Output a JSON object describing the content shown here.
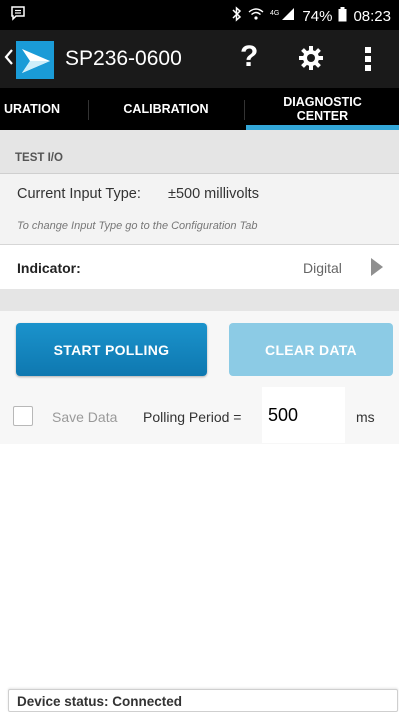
{
  "status_bar": {
    "battery": "74%",
    "time": "08:23",
    "icons": [
      "chat-icon",
      "bluetooth-icon",
      "wifi-icon",
      "4g-signal-icon",
      "battery-icon"
    ]
  },
  "app_bar": {
    "title": "SP236-0600",
    "help_label": "?",
    "icons": [
      "back-chevron-icon",
      "app-logo-icon",
      "help-icon",
      "gear-icon",
      "overflow-menu-icon"
    ]
  },
  "tabs": [
    {
      "label": "URATION"
    },
    {
      "label": "CALIBRATION"
    },
    {
      "label": "DIAGNOSTIC\nCENTER",
      "selected": true
    }
  ],
  "section": {
    "header": "TEST I/O",
    "current_input_type_label": "Current Input Type:",
    "current_input_type_value": "±500 millivolts",
    "hint": "To change Input Type go to the Configuration Tab",
    "indicator_label": "Indicator:",
    "indicator_value": "Digital"
  },
  "controls": {
    "start_label": "START POLLING",
    "clear_label": "CLEAR DATA",
    "save_data_label": "Save Data",
    "save_data_checked": false,
    "polling_period_label": "Polling Period =",
    "polling_period_value": "500",
    "unit": "ms"
  },
  "footer": {
    "device_status": "Device status:  Connected"
  },
  "colors": {
    "accent": "#33a7d8",
    "start_button": "#1b93cc",
    "clear_button_disabled": "#8ccbe5",
    "app_bar": "#1a1a1a"
  }
}
